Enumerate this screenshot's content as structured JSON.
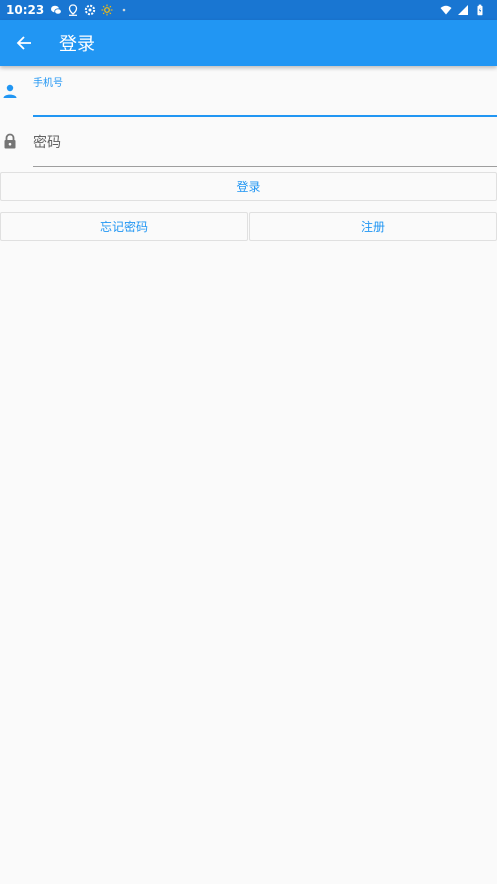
{
  "status_bar": {
    "time": "10:23",
    "icons": [
      "wechat-icon",
      "location-icon",
      "settings-icon",
      "brightness-icon",
      "dot-icon",
      "wifi-icon",
      "signal-icon",
      "battery-icon"
    ]
  },
  "app_bar": {
    "title": "登录",
    "back_icon": "arrow-left-icon",
    "color": "#2196f3"
  },
  "form": {
    "phone": {
      "label": "手机号",
      "value": "",
      "icon": "person-icon"
    },
    "password": {
      "placeholder": "密码",
      "value": "",
      "icon": "lock-icon"
    },
    "login_button": "登录",
    "forgot_button": "忘记密码",
    "register_button": "注册"
  },
  "colors": {
    "accent": "#2196f3",
    "status_bar": "#1976d2",
    "background": "#fafafa"
  }
}
